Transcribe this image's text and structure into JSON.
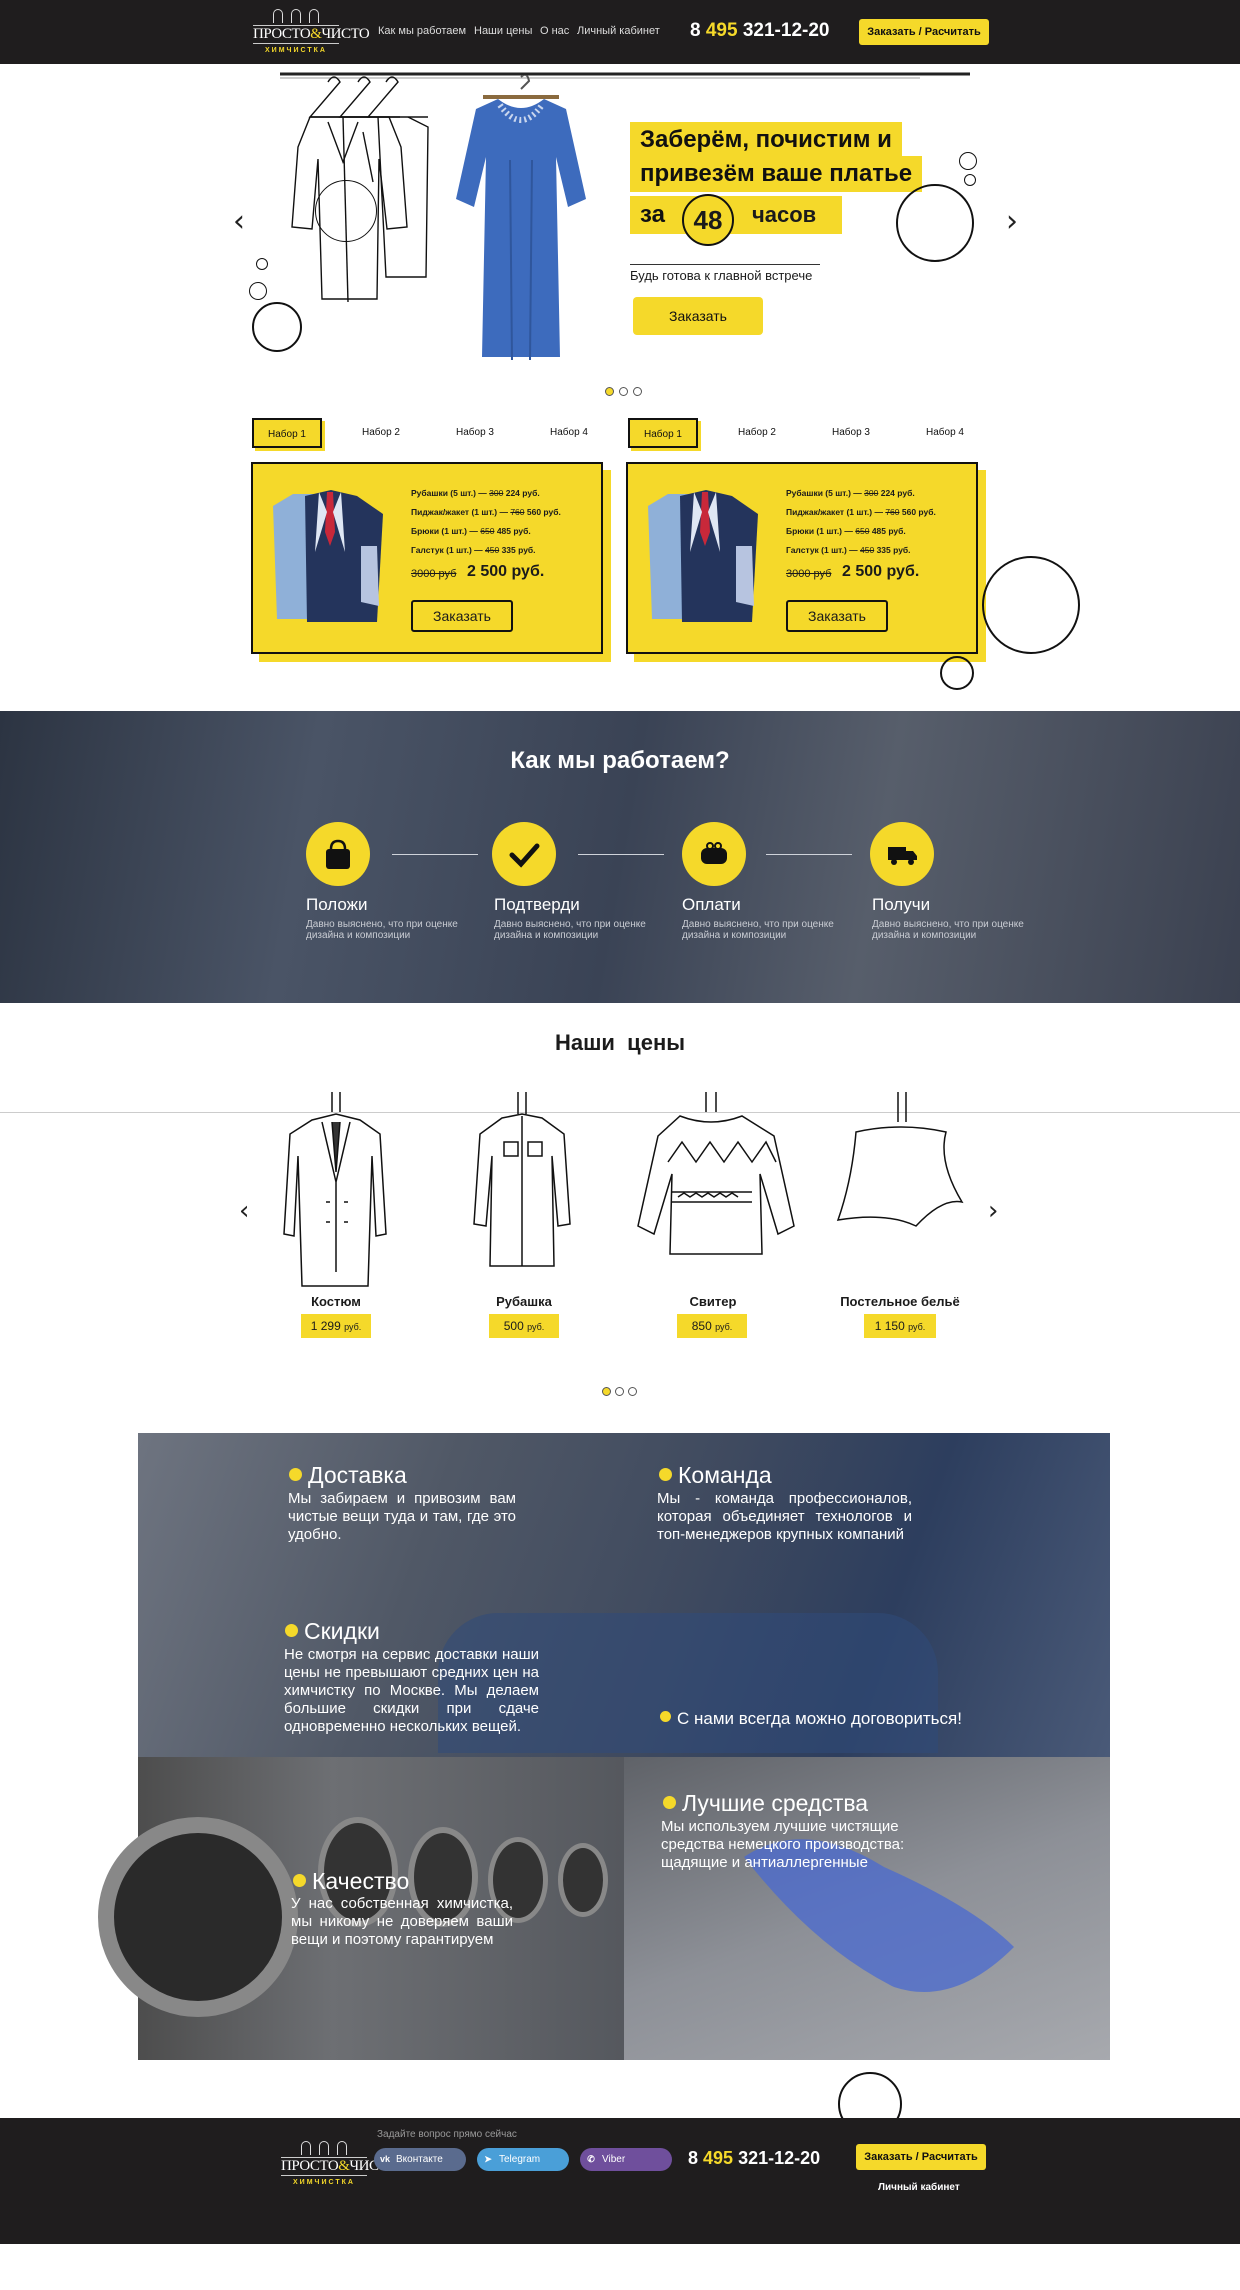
{
  "header": {
    "logo_top": "ПРОСТО",
    "logo_amp": "&",
    "logo_bottom": "ЧИСТО",
    "logo_sub": "ХИМЧИСТКА",
    "nav": [
      "Как мы работаем",
      "Наши цены",
      "О нас",
      "Личный кабинет"
    ],
    "phone_prefix": "8",
    "phone_code": "495",
    "phone_number": "321-12-20",
    "cta": "Заказать / Расчитать"
  },
  "hero": {
    "line1": "Заберём, почистим и",
    "line2": "привезём ваше платье",
    "za": "за",
    "hours": "48",
    "hours_label": "часов",
    "subtitle": "Будь готова к главной встрече",
    "button": "Заказать",
    "prev": "‹",
    "next": "›"
  },
  "sets": {
    "tabs": [
      "Набор 1",
      "Набор 2",
      "Набор 3",
      "Набор 4"
    ],
    "cards": [
      {
        "items": [
          {
            "name": "Рубашки (5 шт.)",
            "old": "300",
            "new": "224 руб."
          },
          {
            "name": "Пиджак/жакет (1 шт.)",
            "old": "760",
            "new": "560 руб."
          },
          {
            "name": "Брюки (1 шт.)",
            "old": "650",
            "new": "485 руб."
          },
          {
            "name": "Галстук (1 шт.)",
            "old": "450",
            "new": "335 руб."
          }
        ],
        "old_price": "3000 руб",
        "new_price": "2 500 руб.",
        "button": "Заказать"
      },
      {
        "items": [
          {
            "name": "Рубашки (5 шт.)",
            "old": "300",
            "new": "224 руб."
          },
          {
            "name": "Пиджак/жакет (1 шт.)",
            "old": "760",
            "new": "560 руб."
          },
          {
            "name": "Брюки (1 шт.)",
            "old": "650",
            "new": "485 руб."
          },
          {
            "name": "Галстук (1 шт.)",
            "old": "450",
            "new": "335 руб."
          }
        ],
        "old_price": "3000 руб",
        "new_price": "2 500 руб.",
        "button": "Заказать"
      }
    ]
  },
  "how": {
    "title": "Как мы работаем?",
    "steps": [
      {
        "title": "Положи",
        "desc": "Давно выяснено, что при оценке дизайна и композиции",
        "icon": "bag-icon"
      },
      {
        "title": "Подтверди",
        "desc": "Давно выяснено, что при оценке дизайна и композиции",
        "icon": "check-icon"
      },
      {
        "title": "Оплати",
        "desc": "Давно выяснено, что при оценке дизайна и композиции",
        "icon": "wallet-icon"
      },
      {
        "title": "Получи",
        "desc": "Давно выяснено, что при оценке дизайна и композиции",
        "icon": "truck-icon"
      }
    ]
  },
  "prices": {
    "title": "Наши  цены",
    "items": [
      {
        "name": "Костюм",
        "price": "1 299",
        "unit": "руб."
      },
      {
        "name": "Рубашка",
        "price": "500",
        "unit": "руб."
      },
      {
        "name": "Свитер",
        "price": "850",
        "unit": "руб."
      },
      {
        "name": "Постельное бельё",
        "price": "1 150",
        "unit": "руб."
      }
    ]
  },
  "features": {
    "delivery": {
      "title": "Доставка",
      "text": "Мы забираем и привозим вам чистые вещи туда и там, где это удобно."
    },
    "team": {
      "title": "Команда",
      "text": "Мы - команда профессионалов, которая объединяет технологов и топ-менеджеров крупных компаний"
    },
    "discounts": {
      "title": "Скидки",
      "text": "Не смотря на сервис доставки наши цены не превышают средних цен на химчистку по Москве. Мы делаем большие скидки при сдаче одновременно нескольких вещей."
    },
    "negotiate": {
      "title": "С нами всегда можно договориться!"
    },
    "quality": {
      "title": "Качество",
      "text": "У нас собственная химчистка, мы никому не доверяем ваши вещи и поэтому гарантируем"
    },
    "products": {
      "title": "Лучшие средства",
      "text": "Мы используем лучшие чистящие средства немецкого производства: щадящие и антиаллергенные"
    }
  },
  "footer": {
    "ask": "Задайте вопрос прямо сейчас",
    "socials": [
      {
        "label": "Вконтакте",
        "color": "#5a6b8e"
      },
      {
        "label": "Telegram",
        "color": "#4a9fd8"
      },
      {
        "label": "Viber",
        "color": "#6f4f9c"
      }
    ],
    "phone_prefix": "8",
    "phone_code": "495",
    "phone_number": "321-12-20",
    "cta": "Заказать / Расчитать",
    "cabinet": "Личный кабинет"
  },
  "colors": {
    "accent": "#f5d92a",
    "dark": "#1f1d1e"
  }
}
